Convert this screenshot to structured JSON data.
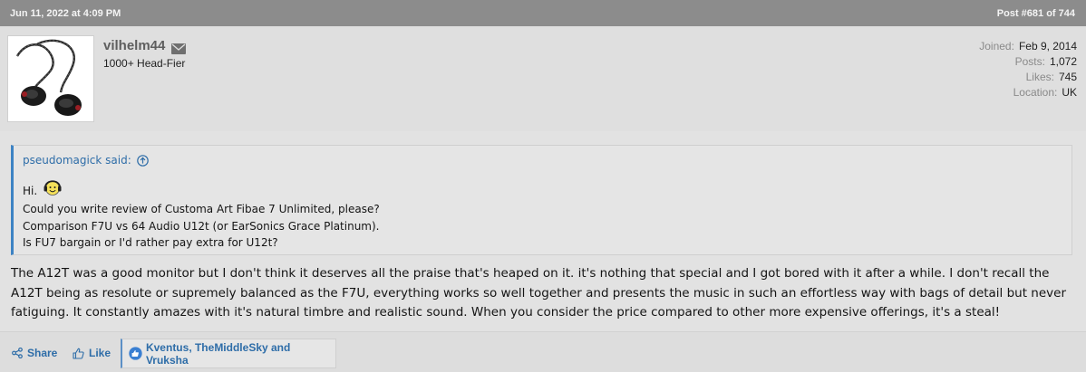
{
  "post_header": {
    "timestamp": "Jun 11, 2022 at 4:09 PM",
    "post_number": "Post #681 of 744"
  },
  "author": {
    "username": "vilhelm44",
    "title": "1000+ Head-Fier",
    "stats": [
      {
        "label": "Joined:",
        "value": "Feb 9, 2014"
      },
      {
        "label": "Posts:",
        "value": "1,072"
      },
      {
        "label": "Likes:",
        "value": "745"
      },
      {
        "label": "Location:",
        "value": "UK"
      }
    ]
  },
  "quote": {
    "attribution": "pseudomagick said:",
    "lines": [
      "Hi.",
      "Could you write review of Customa Art Fibae 7 Unlimited, please?",
      "Comparison F7U vs 64 Audio U12t (or EarSonics Grace Platinum).",
      "Is FU7 bargain or I'd rather pay extra for U12t?"
    ]
  },
  "body": {
    "text": "The A12T was a good monitor but I don't think it deserves all the praise that's heaped on it. it's nothing that special and I got bored with it after a while. I don't recall the A12T being as resolute or supremely balanced as the F7U, everything works so well together and presents the music in such an effortless way with bags of detail but never fatiguing. It constantly amazes with it's natural timbre and realistic sound. When you consider the price compared to other more expensive offerings, it's a steal!"
  },
  "actions": {
    "share_label": "Share",
    "like_label": "Like",
    "reactions_text": "Kventus, TheMiddleSky and Vruksha"
  },
  "icons": {
    "mail": "envelope-icon",
    "quote_jump": "arrow-up-circle-icon",
    "share": "share-icon",
    "like": "thumbs-up-icon",
    "reaction": "like-reaction-icon"
  },
  "colors": {
    "header_bar": "#8c8c8c",
    "link_blue": "#2e6da8",
    "quote_border": "#3d83c4"
  }
}
